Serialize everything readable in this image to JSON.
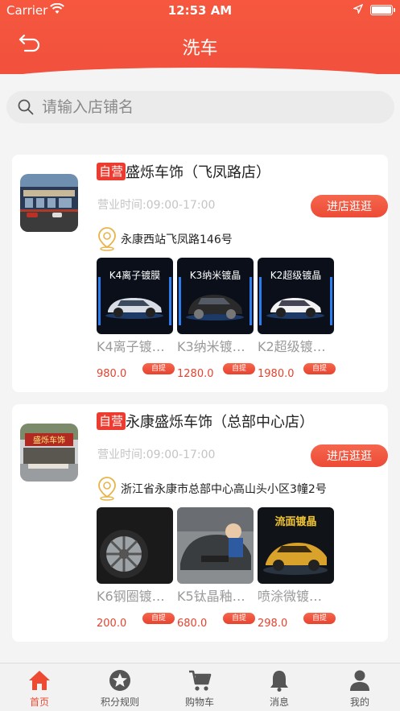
{
  "status_bar": {
    "carrier": "Carrier",
    "time": "12:53 AM"
  },
  "header": {
    "title": "洗车",
    "back_icon": "back-arrow-icon"
  },
  "search": {
    "placeholder": "请输入店铺名"
  },
  "colors": {
    "accent": "#f1513d",
    "price": "#e5432f",
    "muted": "#9a9a9a"
  },
  "stores": [
    {
      "badge": "自营",
      "name": "盛烁车饰（飞凤路店）",
      "hours": "营业时间:09:00-17:00",
      "enter_label": "进店逛逛",
      "address": "永康西站飞凤路146号",
      "products": [
        {
          "image_text": "K4离子镀膜",
          "name": "K4离子镀…",
          "price": "980.0",
          "tag": "自提"
        },
        {
          "image_text": "K3纳米镀晶",
          "name": "K3纳米镀…",
          "price": "1280.0",
          "tag": "自提"
        },
        {
          "image_text": "K2超级镀晶",
          "name": "K2超级镀…",
          "price": "1980.0",
          "tag": "自提"
        }
      ]
    },
    {
      "badge": "自营",
      "name": "永康盛烁车饰（总部中心店）",
      "hours": "营业时间:09:00-17:00",
      "enter_label": "进店逛逛",
      "address": "浙江省永康市总部中心高山头小区3幢2号",
      "storefront_sign": "盛烁车饰",
      "products": [
        {
          "name": "K6钢圈镀…",
          "price": "200.0",
          "tag": "自提"
        },
        {
          "name": "K5钛晶釉…",
          "price": "680.0",
          "tag": "自提"
        },
        {
          "image_text": "流面镀晶",
          "name": "喷涂微镀…",
          "price": "298.0",
          "tag": "自提"
        }
      ]
    }
  ],
  "tabbar": [
    {
      "label": "首页",
      "icon": "home-icon",
      "active": true
    },
    {
      "label": "积分规则",
      "icon": "star-icon",
      "active": false
    },
    {
      "label": "购物车",
      "icon": "cart-icon",
      "active": false
    },
    {
      "label": "消息",
      "icon": "bell-icon",
      "active": false
    },
    {
      "label": "我的",
      "icon": "person-icon",
      "active": false
    }
  ]
}
